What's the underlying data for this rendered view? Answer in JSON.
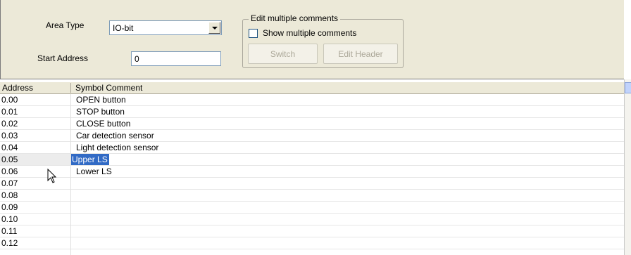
{
  "form": {
    "area_type_label": "Area Type",
    "area_type_value": "IO-bit",
    "start_address_label": "Start Address",
    "start_address_value": "0"
  },
  "edit_multiple": {
    "legend": "Edit multiple comments",
    "show_multiple_label": "Show multiple comments",
    "show_multiple_checked": false,
    "switch_label": "Switch",
    "edit_header_label": "Edit Header"
  },
  "grid": {
    "columns": [
      "Address",
      "Symbol Comment"
    ],
    "rows": [
      {
        "address": "0.00",
        "comment": "OPEN button"
      },
      {
        "address": "0.01",
        "comment": "STOP button"
      },
      {
        "address": "0.02",
        "comment": "CLOSE button"
      },
      {
        "address": "0.03",
        "comment": "Car detection sensor"
      },
      {
        "address": "0.04",
        "comment": "Light detection sensor"
      },
      {
        "address": "0.05",
        "comment": "Upper LS"
      },
      {
        "address": "0.06",
        "comment": "Lower LS"
      },
      {
        "address": "0.07",
        "comment": ""
      },
      {
        "address": "0.08",
        "comment": ""
      },
      {
        "address": "0.09",
        "comment": ""
      },
      {
        "address": "0.10",
        "comment": ""
      },
      {
        "address": "0.11",
        "comment": ""
      },
      {
        "address": "0.12",
        "comment": ""
      }
    ],
    "selected_row": 5
  },
  "colors": {
    "panel_bg": "#ece9d8",
    "selection": "#316ac5",
    "disabled_text": "#aca899"
  },
  "icons": {
    "dropdown": "chevron-down-icon",
    "cursor": "mouse-pointer-icon"
  }
}
